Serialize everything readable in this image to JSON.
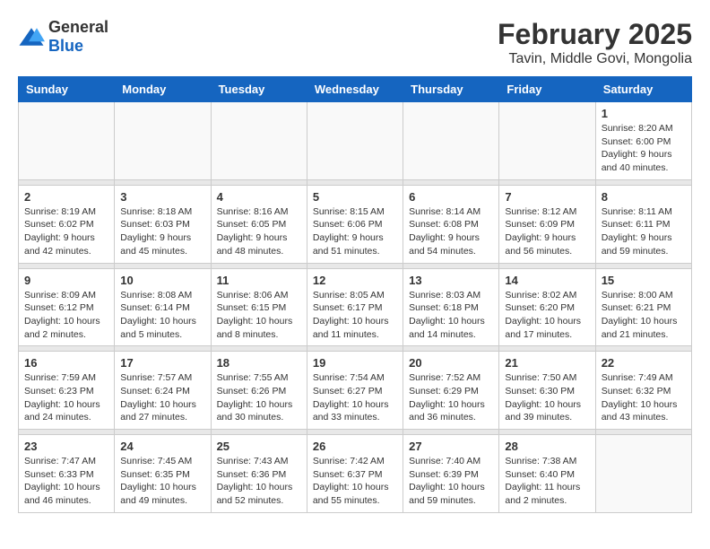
{
  "logo": {
    "general": "General",
    "blue": "Blue"
  },
  "title": "February 2025",
  "subtitle": "Tavin, Middle Govi, Mongolia",
  "days_of_week": [
    "Sunday",
    "Monday",
    "Tuesday",
    "Wednesday",
    "Thursday",
    "Friday",
    "Saturday"
  ],
  "weeks": [
    [
      {
        "day": "",
        "info": ""
      },
      {
        "day": "",
        "info": ""
      },
      {
        "day": "",
        "info": ""
      },
      {
        "day": "",
        "info": ""
      },
      {
        "day": "",
        "info": ""
      },
      {
        "day": "",
        "info": ""
      },
      {
        "day": "1",
        "info": "Sunrise: 8:20 AM\nSunset: 6:00 PM\nDaylight: 9 hours and 40 minutes."
      }
    ],
    [
      {
        "day": "2",
        "info": "Sunrise: 8:19 AM\nSunset: 6:02 PM\nDaylight: 9 hours and 42 minutes."
      },
      {
        "day": "3",
        "info": "Sunrise: 8:18 AM\nSunset: 6:03 PM\nDaylight: 9 hours and 45 minutes."
      },
      {
        "day": "4",
        "info": "Sunrise: 8:16 AM\nSunset: 6:05 PM\nDaylight: 9 hours and 48 minutes."
      },
      {
        "day": "5",
        "info": "Sunrise: 8:15 AM\nSunset: 6:06 PM\nDaylight: 9 hours and 51 minutes."
      },
      {
        "day": "6",
        "info": "Sunrise: 8:14 AM\nSunset: 6:08 PM\nDaylight: 9 hours and 54 minutes."
      },
      {
        "day": "7",
        "info": "Sunrise: 8:12 AM\nSunset: 6:09 PM\nDaylight: 9 hours and 56 minutes."
      },
      {
        "day": "8",
        "info": "Sunrise: 8:11 AM\nSunset: 6:11 PM\nDaylight: 9 hours and 59 minutes."
      }
    ],
    [
      {
        "day": "9",
        "info": "Sunrise: 8:09 AM\nSunset: 6:12 PM\nDaylight: 10 hours and 2 minutes."
      },
      {
        "day": "10",
        "info": "Sunrise: 8:08 AM\nSunset: 6:14 PM\nDaylight: 10 hours and 5 minutes."
      },
      {
        "day": "11",
        "info": "Sunrise: 8:06 AM\nSunset: 6:15 PM\nDaylight: 10 hours and 8 minutes."
      },
      {
        "day": "12",
        "info": "Sunrise: 8:05 AM\nSunset: 6:17 PM\nDaylight: 10 hours and 11 minutes."
      },
      {
        "day": "13",
        "info": "Sunrise: 8:03 AM\nSunset: 6:18 PM\nDaylight: 10 hours and 14 minutes."
      },
      {
        "day": "14",
        "info": "Sunrise: 8:02 AM\nSunset: 6:20 PM\nDaylight: 10 hours and 17 minutes."
      },
      {
        "day": "15",
        "info": "Sunrise: 8:00 AM\nSunset: 6:21 PM\nDaylight: 10 hours and 21 minutes."
      }
    ],
    [
      {
        "day": "16",
        "info": "Sunrise: 7:59 AM\nSunset: 6:23 PM\nDaylight: 10 hours and 24 minutes."
      },
      {
        "day": "17",
        "info": "Sunrise: 7:57 AM\nSunset: 6:24 PM\nDaylight: 10 hours and 27 minutes."
      },
      {
        "day": "18",
        "info": "Sunrise: 7:55 AM\nSunset: 6:26 PM\nDaylight: 10 hours and 30 minutes."
      },
      {
        "day": "19",
        "info": "Sunrise: 7:54 AM\nSunset: 6:27 PM\nDaylight: 10 hours and 33 minutes."
      },
      {
        "day": "20",
        "info": "Sunrise: 7:52 AM\nSunset: 6:29 PM\nDaylight: 10 hours and 36 minutes."
      },
      {
        "day": "21",
        "info": "Sunrise: 7:50 AM\nSunset: 6:30 PM\nDaylight: 10 hours and 39 minutes."
      },
      {
        "day": "22",
        "info": "Sunrise: 7:49 AM\nSunset: 6:32 PM\nDaylight: 10 hours and 43 minutes."
      }
    ],
    [
      {
        "day": "23",
        "info": "Sunrise: 7:47 AM\nSunset: 6:33 PM\nDaylight: 10 hours and 46 minutes."
      },
      {
        "day": "24",
        "info": "Sunrise: 7:45 AM\nSunset: 6:35 PM\nDaylight: 10 hours and 49 minutes."
      },
      {
        "day": "25",
        "info": "Sunrise: 7:43 AM\nSunset: 6:36 PM\nDaylight: 10 hours and 52 minutes."
      },
      {
        "day": "26",
        "info": "Sunrise: 7:42 AM\nSunset: 6:37 PM\nDaylight: 10 hours and 55 minutes."
      },
      {
        "day": "27",
        "info": "Sunrise: 7:40 AM\nSunset: 6:39 PM\nDaylight: 10 hours and 59 minutes."
      },
      {
        "day": "28",
        "info": "Sunrise: 7:38 AM\nSunset: 6:40 PM\nDaylight: 11 hours and 2 minutes."
      },
      {
        "day": "",
        "info": ""
      }
    ]
  ]
}
